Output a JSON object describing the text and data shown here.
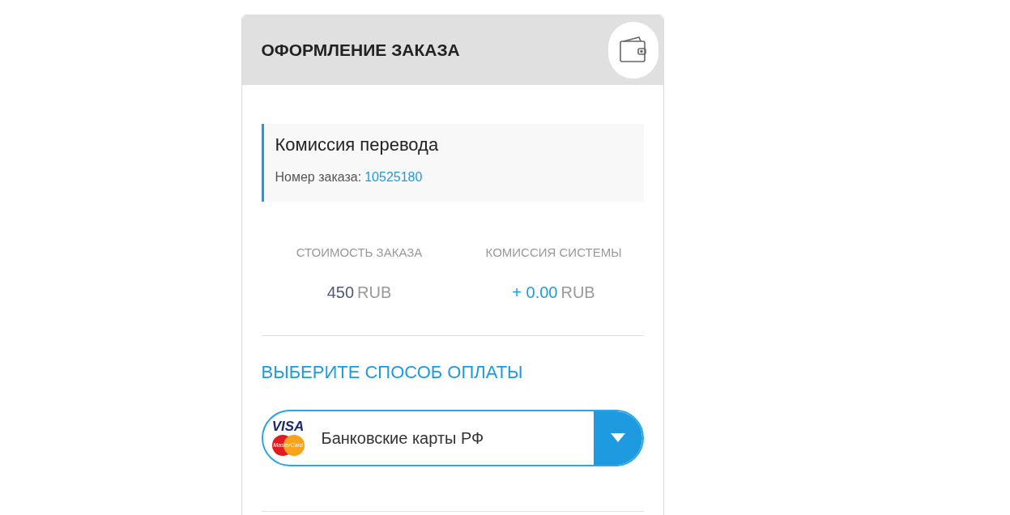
{
  "header": {
    "title": "ОФОРМЛЕНИЕ ЗАКАЗА"
  },
  "order": {
    "title": "Комиссия перевода",
    "number_label": "Номер заказа:",
    "number": "10525180"
  },
  "stats": [
    {
      "label": "СТОИМОСТЬ ЗАКАЗА",
      "amount": "450",
      "currency": "RUB",
      "kind": "price"
    },
    {
      "label": "КОМИССИЯ СИСТЕМЫ",
      "amount": "+ 0.00",
      "currency": "RUB",
      "kind": "fee"
    }
  ],
  "payment": {
    "heading": "ВЫБЕРИТЕ СПОСОБ ОПЛАТЫ",
    "selected_method": "Банковские карты РФ",
    "logo_texts": [
      "VISA",
      "MasterCard"
    ]
  }
}
